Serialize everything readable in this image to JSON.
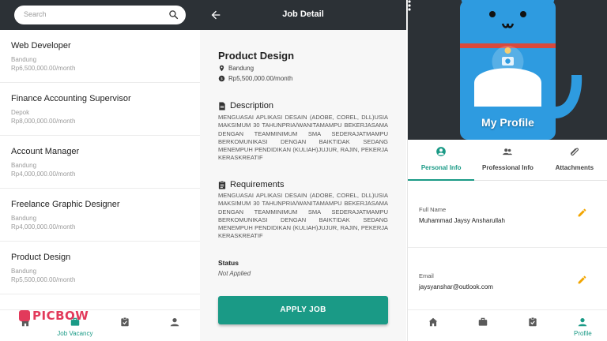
{
  "colors": {
    "accent": "#1a9a86",
    "header": "#2c3136",
    "watermark": "#e23a5b",
    "edit": "#f2a500"
  },
  "vacancy_list": {
    "search_placeholder": "Search",
    "jobs": [
      {
        "title": "Web Developer",
        "location": "Bandung",
        "salary": "Rp6,500,000.00/month"
      },
      {
        "title": "Finance Accounting Supervisor",
        "location": "Depok",
        "salary": "Rp8,000,000.00/month"
      },
      {
        "title": "Account Manager",
        "location": "Bandung",
        "salary": "Rp4,000,000.00/month"
      },
      {
        "title": "Freelance Graphic Designer",
        "location": "Bandung",
        "salary": "Rp4,000,000.00/month"
      },
      {
        "title": "Product Design",
        "location": "Bandung",
        "salary": "Rp5,500,000.00/month"
      }
    ],
    "bottom_nav": {
      "active_label": "Job Vacancy",
      "icons": [
        "home-icon",
        "briefcase-icon",
        "assignment-icon",
        "person-icon"
      ]
    },
    "watermark": "PICBOW"
  },
  "job_detail": {
    "header_title": "Job Detail",
    "title": "Product Design",
    "location": "Bandung",
    "salary": "Rp5,500,000.00/month",
    "description_heading": "Description",
    "description_text": "Menguasai aplikasi desain (adobe, corel, dll)usia maksimum 30 tahunpria/wanitamampu bekerjasama dengan teamminimum SMA sederajatmampu berkomunikasi dengan baiktidak sedang menempuh pendidikan (kuliah)jujur, rajin, pekerja keraskreatif",
    "requirements_heading": "Requirements",
    "requirements_text": "Menguasai aplikasi desain (adobe, corel, dll)usia maksimum 30 tahunpria/wanitamampu bekerjasama dengan teamminimum SMA sederajatmampu berkomunikasi dengan baiktidak sedang menempuh pendidikan (kuliah)jujur, rajin, pekerja keraskreatif",
    "status_label": "Status",
    "status_value": "Not Applied",
    "apply_button": "APPLY JOB"
  },
  "profile": {
    "caption": "My Profile",
    "tabs": [
      {
        "label": "Personal Info",
        "icon": "account-circle-icon",
        "active": true
      },
      {
        "label": "Professional Info",
        "icon": "group-icon",
        "active": false
      },
      {
        "label": "Attachments",
        "icon": "paperclip-icon",
        "active": false
      }
    ],
    "fields": [
      {
        "label": "Full Name",
        "value": "Muhammad Jaysy Ansharullah"
      },
      {
        "label": "Email",
        "value": "jaysyanshar@outlook.com"
      }
    ],
    "bottom_nav": {
      "active_label": "Profile",
      "icons": [
        "home-icon",
        "briefcase-icon",
        "assignment-icon",
        "person-icon"
      ]
    }
  }
}
